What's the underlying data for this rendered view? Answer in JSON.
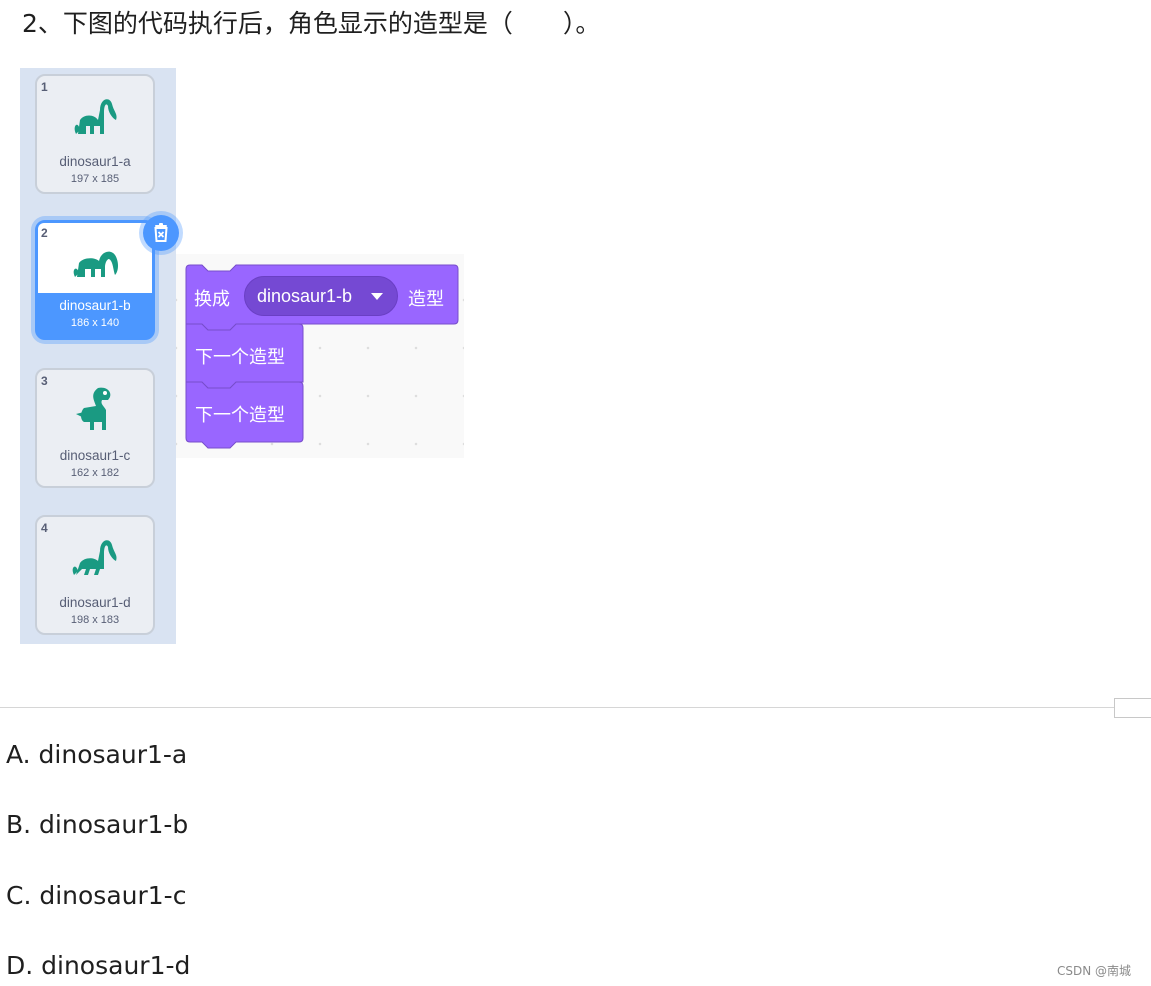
{
  "question": {
    "text": "2、下图的代码执行后，角色显示的造型是（　　）。"
  },
  "costumes": [
    {
      "number": "1",
      "name": "dinosaur1-a",
      "size": "197 x 185"
    },
    {
      "number": "2",
      "name": "dinosaur1-b",
      "size": "186 x 140",
      "selected": true
    },
    {
      "number": "3",
      "name": "dinosaur1-c",
      "size": "162 x 182"
    },
    {
      "number": "4",
      "name": "dinosaur1-d",
      "size": "198 x 183"
    }
  ],
  "script": {
    "switch_block": {
      "prefix": "换成",
      "dropdown_value": "dinosaur1-b",
      "suffix": "造型"
    },
    "next_block_1": {
      "label": "下一个造型"
    },
    "next_block_2": {
      "label": "下一个造型"
    }
  },
  "options": [
    {
      "label": "A. dinosaur1-a"
    },
    {
      "label": "B. dinosaur1-b"
    },
    {
      "label": "C. dinosaur1-c"
    },
    {
      "label": "D. dinosaur1-d"
    }
  ],
  "watermark": "CSDN @南城",
  "colors": {
    "looks_block": "#9966ff",
    "looks_block_border": "#774dcb",
    "selected_costume": "#4c97ff",
    "dinosaur": "#1a9a82",
    "panel_bg": "#d9e3f2"
  },
  "icons": {
    "delete": "trash-icon",
    "costume_thumbnail": "dinosaur-icon",
    "dropdown": "caret-down-icon"
  }
}
